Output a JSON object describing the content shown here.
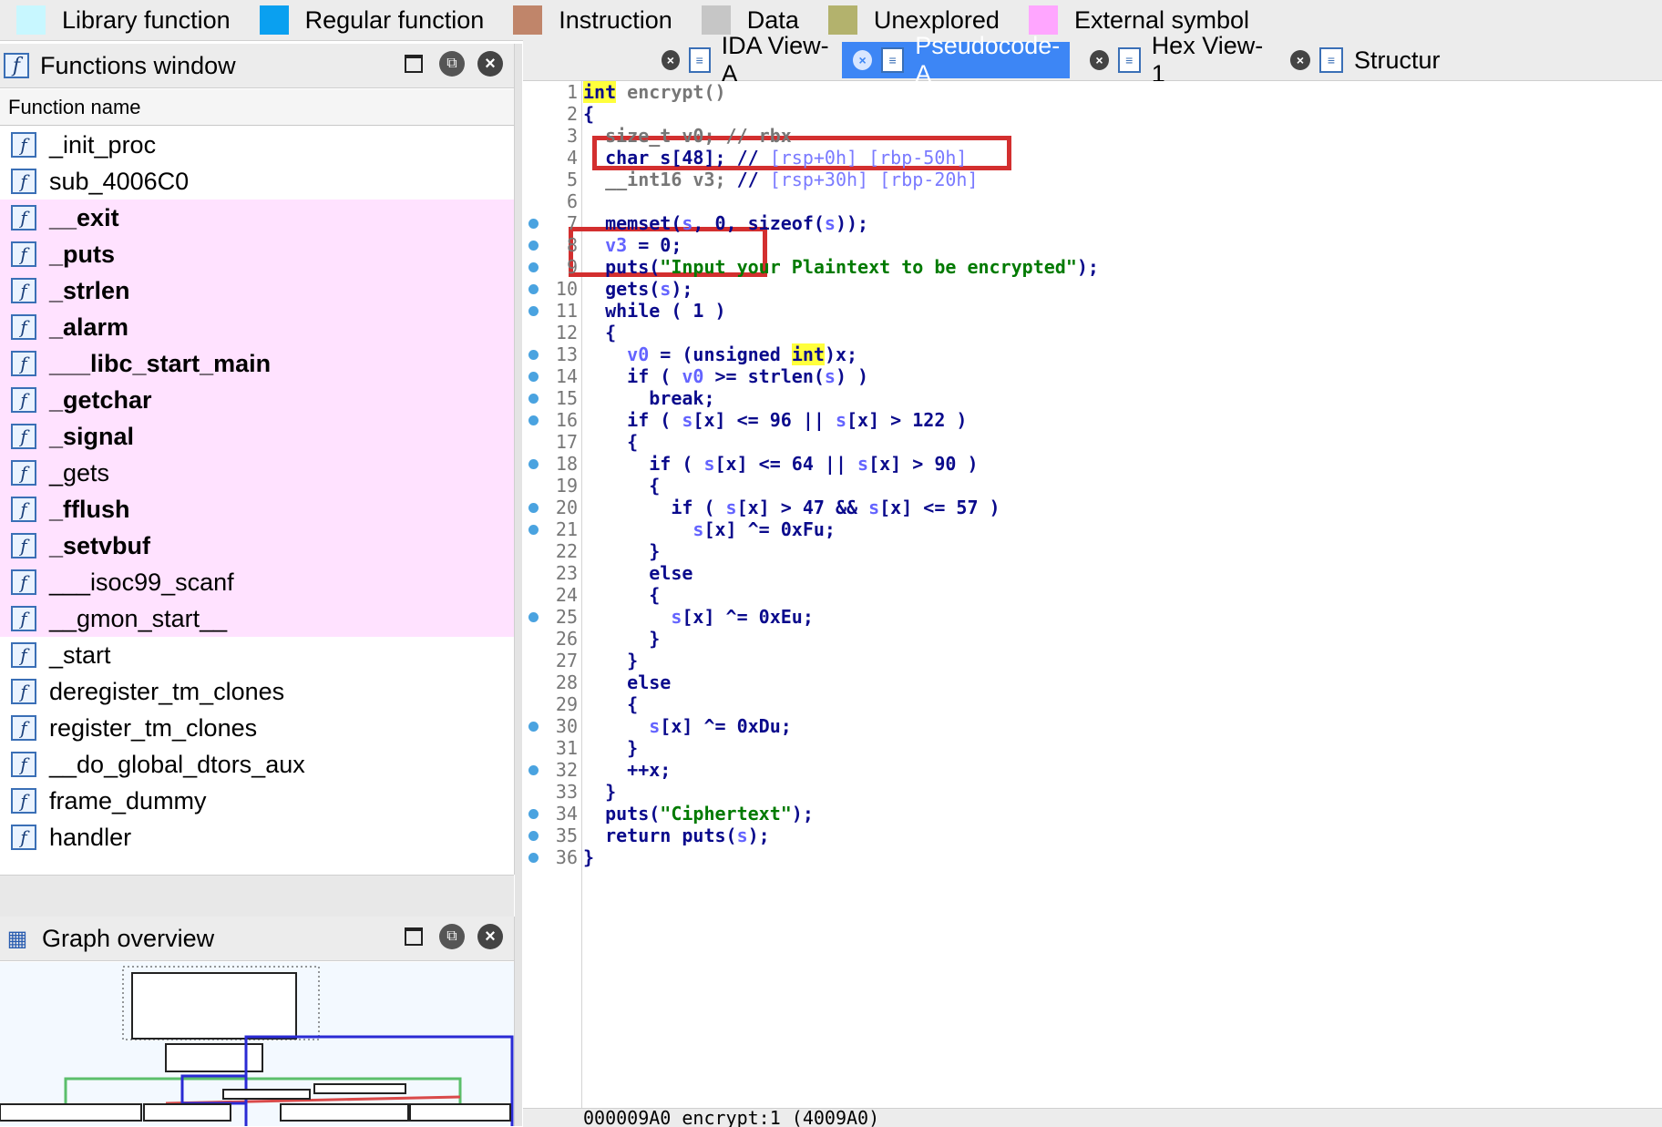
{
  "legend": [
    {
      "label": "Library function",
      "color": "#c8f7ff"
    },
    {
      "label": "Regular function",
      "color": "#0aa0f0"
    },
    {
      "label": "Instruction",
      "color": "#c0856a"
    },
    {
      "label": "Data",
      "color": "#c6c6c6"
    },
    {
      "label": "Unexplored",
      "color": "#b3b26d"
    },
    {
      "label": "External symbol",
      "color": "#ffa6ff"
    }
  ],
  "functions_window": {
    "title": "Functions window",
    "column_header": "Function name",
    "functions": [
      {
        "name": "_init_proc",
        "external": false,
        "bold": false
      },
      {
        "name": "sub_4006C0",
        "external": false,
        "bold": false
      },
      {
        "name": "__exit",
        "external": true,
        "bold": true
      },
      {
        "name": "_puts",
        "external": true,
        "bold": true
      },
      {
        "name": "_strlen",
        "external": true,
        "bold": true
      },
      {
        "name": "_alarm",
        "external": true,
        "bold": true
      },
      {
        "name": "___libc_start_main",
        "external": true,
        "bold": true
      },
      {
        "name": "_getchar",
        "external": true,
        "bold": true
      },
      {
        "name": "_signal",
        "external": true,
        "bold": true
      },
      {
        "name": "_gets",
        "external": true,
        "bold": false
      },
      {
        "name": "_fflush",
        "external": true,
        "bold": true
      },
      {
        "name": "_setvbuf",
        "external": true,
        "bold": true
      },
      {
        "name": "___isoc99_scanf",
        "external": true,
        "bold": false
      },
      {
        "name": "__gmon_start__",
        "external": true,
        "bold": false
      },
      {
        "name": "_start",
        "external": false,
        "bold": false
      },
      {
        "name": "deregister_tm_clones",
        "external": false,
        "bold": false
      },
      {
        "name": "register_tm_clones",
        "external": false,
        "bold": false
      },
      {
        "name": "__do_global_dtors_aux",
        "external": false,
        "bold": false
      },
      {
        "name": "frame_dummy",
        "external": false,
        "bold": false
      },
      {
        "name": "handler",
        "external": false,
        "bold": false
      }
    ]
  },
  "graph_overview": {
    "title": "Graph overview"
  },
  "tabs": [
    {
      "label": "IDA View-A",
      "active": false
    },
    {
      "label": "Pseudocode-A",
      "active": true
    },
    {
      "label": "Hex View-1",
      "active": false
    },
    {
      "label": "Structur",
      "active": false
    }
  ],
  "code_lines": [
    {
      "n": "1",
      "bp": false,
      "html": "<span class=\"hl\">int</span> <span class=\"dim\">encrypt()</span>"
    },
    {
      "n": "2",
      "bp": false,
      "html": "{"
    },
    {
      "n": "3",
      "bp": false,
      "html": "  <span class=\"dim\">size_t v0; // rbx</span>"
    },
    {
      "n": "4",
      "bp": false,
      "html": "  char s[48]; // <span class=\"cmt\">[rsp+0h] [rbp-50h]</span>"
    },
    {
      "n": "5",
      "bp": false,
      "html": "  <span class=\"dim\">__int16 v3;</span> // <span class=\"cmt\">[rsp+30h] [rbp-20h]</span>"
    },
    {
      "n": "6",
      "bp": false,
      "html": ""
    },
    {
      "n": "7",
      "bp": true,
      "html": "  memset(<span class=\"var\">s</span>, 0, sizeof(<span class=\"var\">s</span>));"
    },
    {
      "n": "8",
      "bp": true,
      "html": "  <span class=\"var\">v3</span> = 0;"
    },
    {
      "n": "9",
      "bp": true,
      "html": "  puts(<span class=\"str\">\"Input your Plaintext to be encrypted\"</span>);"
    },
    {
      "n": "10",
      "bp": true,
      "html": "  gets(<span class=\"var\">s</span>);"
    },
    {
      "n": "11",
      "bp": true,
      "html": "  while ( 1 )"
    },
    {
      "n": "12",
      "bp": false,
      "html": "  {"
    },
    {
      "n": "13",
      "bp": true,
      "html": "    <span class=\"var\">v0</span> = (unsigned <span class=\"hl\">int</span>)x;"
    },
    {
      "n": "14",
      "bp": true,
      "html": "    if ( <span class=\"var\">v0</span> >= strlen(<span class=\"var\">s</span>) )"
    },
    {
      "n": "15",
      "bp": true,
      "html": "      break;"
    },
    {
      "n": "16",
      "bp": true,
      "html": "    if ( <span class=\"var\">s</span>[x] <= 96 || <span class=\"var\">s</span>[x] > 122 )"
    },
    {
      "n": "17",
      "bp": false,
      "html": "    {"
    },
    {
      "n": "18",
      "bp": true,
      "html": "      if ( <span class=\"var\">s</span>[x] <= 64 || <span class=\"var\">s</span>[x] > 90 )"
    },
    {
      "n": "19",
      "bp": false,
      "html": "      {"
    },
    {
      "n": "20",
      "bp": true,
      "html": "        if ( <span class=\"var\">s</span>[x] > 47 && <span class=\"var\">s</span>[x] <= 57 )"
    },
    {
      "n": "21",
      "bp": true,
      "html": "          <span class=\"var\">s</span>[x] ^= 0xFu;"
    },
    {
      "n": "22",
      "bp": false,
      "html": "      }"
    },
    {
      "n": "23",
      "bp": false,
      "html": "      else"
    },
    {
      "n": "24",
      "bp": false,
      "html": "      {"
    },
    {
      "n": "25",
      "bp": true,
      "html": "        <span class=\"var\">s</span>[x] ^= 0xEu;"
    },
    {
      "n": "26",
      "bp": false,
      "html": "      }"
    },
    {
      "n": "27",
      "bp": false,
      "html": "    }"
    },
    {
      "n": "28",
      "bp": false,
      "html": "    else"
    },
    {
      "n": "29",
      "bp": false,
      "html": "    {"
    },
    {
      "n": "30",
      "bp": true,
      "html": "      <span class=\"var\">s</span>[x] ^= 0xDu;"
    },
    {
      "n": "31",
      "bp": false,
      "html": "    }"
    },
    {
      "n": "32",
      "bp": true,
      "html": "    ++x;"
    },
    {
      "n": "33",
      "bp": false,
      "html": "  }"
    },
    {
      "n": "34",
      "bp": true,
      "html": "  puts(<span class=\"str\">\"Ciphertext\"</span>);"
    },
    {
      "n": "35",
      "bp": true,
      "html": "  return puts(<span class=\"var\">s</span>);"
    },
    {
      "n": "36",
      "bp": true,
      "html": "}"
    }
  ],
  "status_text": "000009A0 encrypt:1 (4009A0)"
}
